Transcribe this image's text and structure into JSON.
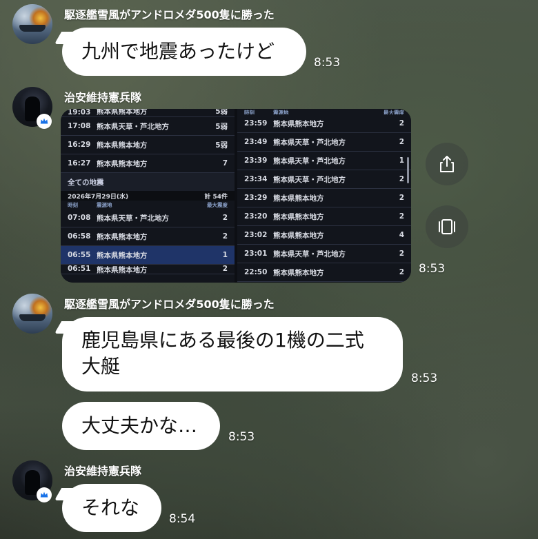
{
  "messages": [
    {
      "sender": "駆逐艦雪風がアンドロメダ500隻に勝った",
      "text": "九州で地震あったけど",
      "time": "8:53"
    },
    {
      "sender": "治安維持憲兵隊",
      "time": "8:53"
    },
    {
      "sender": "駆逐艦雪風がアンドロメダ500隻に勝った",
      "text_line1": "鹿児島県にある最後の1機の二式",
      "text_line2": "大艇",
      "time": "8:53"
    },
    {
      "text": "大丈夫かな…",
      "time": "8:53"
    },
    {
      "sender": "治安維持憲兵隊",
      "text": "それな",
      "time": "8:54"
    }
  ],
  "media_left": {
    "top_rows": [
      {
        "time": "19:03",
        "place": "熊本県熊本地方",
        "scale": "5弱"
      },
      {
        "time": "17:08",
        "place": "熊本県天草・芦北地方",
        "scale": "5弱"
      },
      {
        "time": "16:29",
        "place": "熊本県熊本地方",
        "scale": "5弱"
      },
      {
        "time": "16:27",
        "place": "熊本県熊本地方",
        "scale": "7"
      }
    ],
    "section_title": "全ての地震",
    "date": "2026年7月29日(水)",
    "total": "計 54件",
    "col_time": "時刻",
    "col_place": "震源地",
    "col_scale": "最大震度",
    "bottom_rows": [
      {
        "time": "07:08",
        "place": "熊本県天草・芦北地方",
        "scale": "2"
      },
      {
        "time": "06:58",
        "place": "熊本県熊本地方",
        "scale": "2"
      },
      {
        "time": "06:55",
        "place": "熊本県熊本地方",
        "scale": "1"
      },
      {
        "time": "06:51",
        "place": "熊本県熊本地方",
        "scale": "2"
      }
    ]
  },
  "media_right": {
    "col_time": "時刻",
    "col_place": "震源地",
    "col_scale": "最大震度",
    "rows": [
      {
        "time": "23:59",
        "place": "熊本県熊本地方",
        "scale": "2"
      },
      {
        "time": "23:49",
        "place": "熊本県天草・芦北地方",
        "scale": "2"
      },
      {
        "time": "23:39",
        "place": "熊本県天草・芦北地方",
        "scale": "1"
      },
      {
        "time": "23:34",
        "place": "熊本県天草・芦北地方",
        "scale": "2"
      },
      {
        "time": "23:29",
        "place": "熊本県熊本地方",
        "scale": "2"
      },
      {
        "time": "23:20",
        "place": "熊本県熊本地方",
        "scale": "2"
      },
      {
        "time": "23:02",
        "place": "熊本県熊本地方",
        "scale": "4"
      },
      {
        "time": "23:01",
        "place": "熊本県天草・芦北地方",
        "scale": "2"
      },
      {
        "time": "22:50",
        "place": "熊本県熊本地方",
        "scale": "2"
      }
    ]
  },
  "colors": {
    "bubble": "#ffffff",
    "highlight_row": "#1f3468",
    "crown": "#1a73e8"
  },
  "icons": {
    "share": "share-icon",
    "gallery": "gallery-icon",
    "crown": "crown-icon"
  }
}
